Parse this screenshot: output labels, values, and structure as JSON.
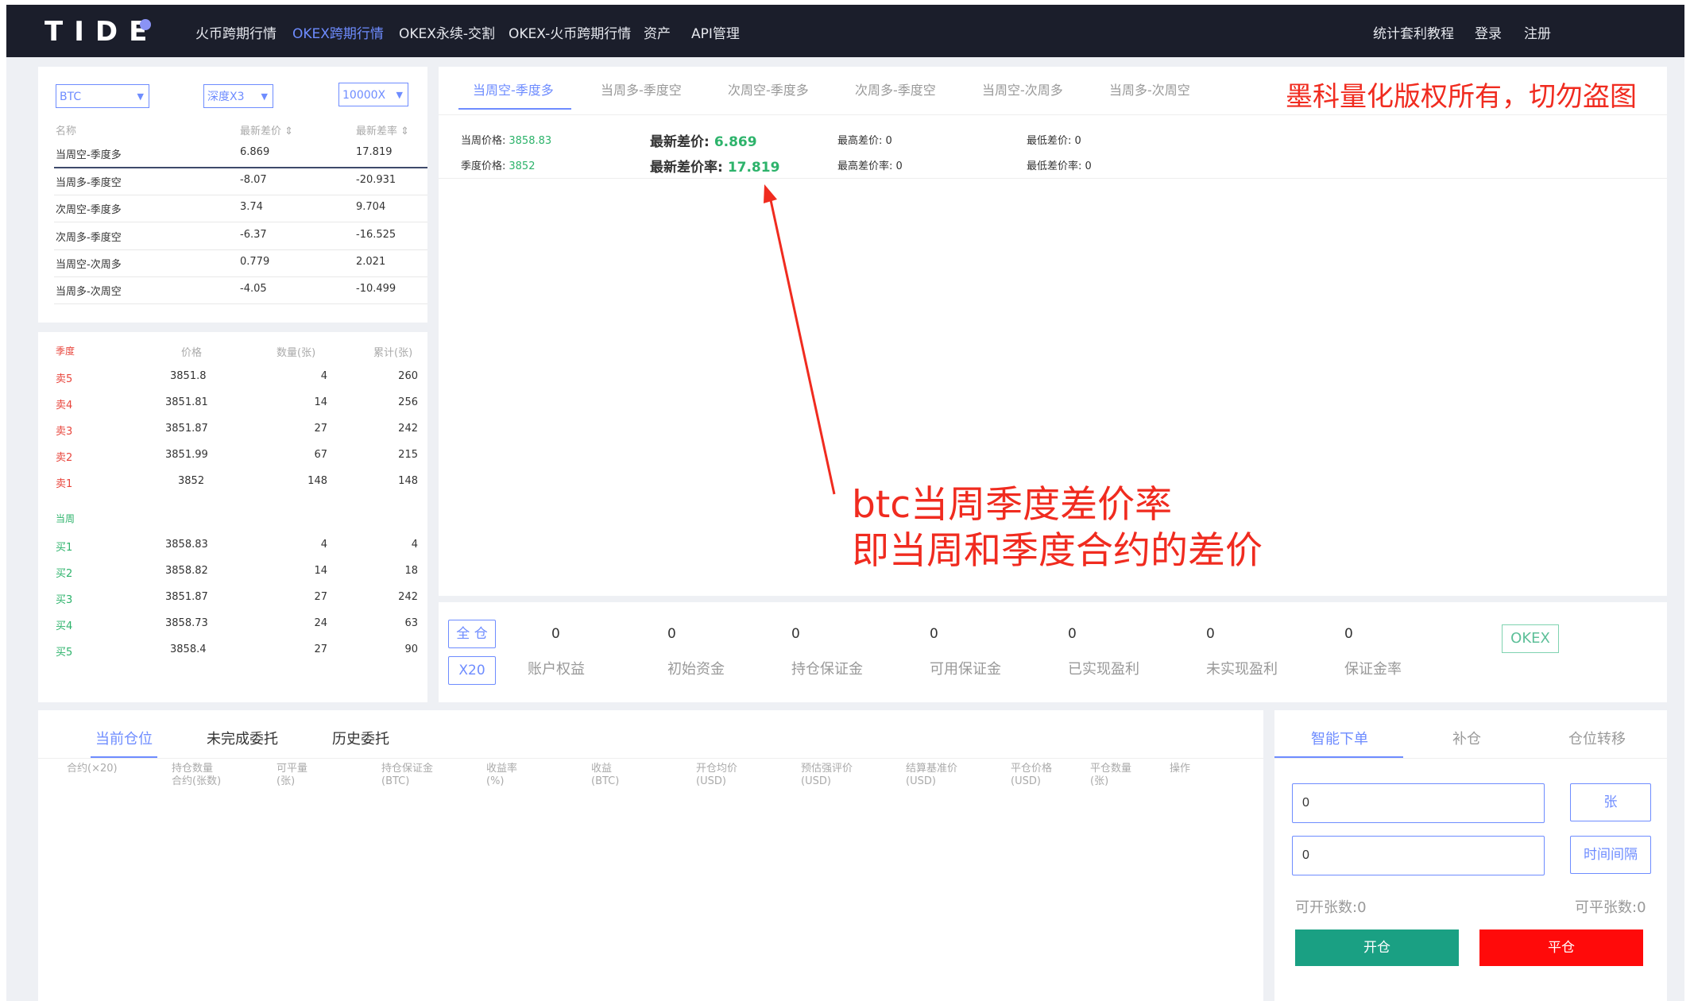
{
  "nav": {
    "logo": "TIDE",
    "items": [
      "火币跨期行情",
      "OKEX跨期行情",
      "OKEX永续-交割",
      "OKEX-火币跨期行情",
      "资产",
      "API管理"
    ],
    "right": [
      "统计套利教程",
      "登录",
      "注册"
    ]
  },
  "filters": {
    "coin": "BTC",
    "depth": "深度X3",
    "amount": "10000X"
  },
  "spread_table": {
    "headers": [
      "名称",
      "最新差价 ⇕",
      "最新差率 ⇕"
    ],
    "rows": [
      [
        "当周空-季度多",
        "6.869",
        "17.819"
      ],
      [
        "当周多-季度空",
        "-8.07",
        "-20.931"
      ],
      [
        "次周空-季度多",
        "3.74",
        "9.704"
      ],
      [
        "次周多-季度空",
        "-6.37",
        "-16.525"
      ],
      [
        "当周空-次周多",
        "0.779",
        "2.021"
      ],
      [
        "当周多-次周空",
        "-4.05",
        "-10.499"
      ]
    ]
  },
  "orderbook": {
    "headers": [
      "季度",
      "价格",
      "数量(张)",
      "累计(张)"
    ],
    "asks": [
      [
        "卖5",
        "3851.8",
        "4",
        "260"
      ],
      [
        "卖4",
        "3851.81",
        "14",
        "256"
      ],
      [
        "卖3",
        "3851.87",
        "27",
        "242"
      ],
      [
        "卖2",
        "3851.99",
        "67",
        "215"
      ],
      [
        "卖1",
        "3852",
        "148",
        "148"
      ]
    ],
    "mid_label": "当周",
    "bids": [
      [
        "买1",
        "3858.83",
        "4",
        "4"
      ],
      [
        "买2",
        "3858.82",
        "14",
        "18"
      ],
      [
        "买3",
        "3851.87",
        "27",
        "242"
      ],
      [
        "买4",
        "3858.73",
        "24",
        "63"
      ],
      [
        "买5",
        "3858.4",
        "27",
        "90"
      ]
    ]
  },
  "chart_tabs": [
    "当周空-季度多",
    "当周多-季度空",
    "次周空-季度多",
    "次周多-季度空",
    "当周空-次周多",
    "当周多-次周空"
  ],
  "watermark": "墨科量化版权所有，切勿盗图",
  "stats": {
    "current_price_label": "当周价格:",
    "current_price": "3858.83",
    "quarter_price_label": "季度价格:",
    "quarter_price": "3852",
    "latest_spread_label": "最新差价:",
    "latest_spread": "6.869",
    "latest_rate_label": "最新差价率:",
    "latest_rate": "17.819",
    "max_spread": "最高差价: 0",
    "max_rate": "最高差价率: 0",
    "min_spread": "最低差价: 0",
    "min_rate": "最低差价率: 0"
  },
  "annotation": {
    "line1": "btc当周季度差价率",
    "line2": "即当周和季度合约的差价"
  },
  "account": {
    "mode": "全 仓",
    "leverage": "X20",
    "exchange": "OKEX",
    "items": [
      {
        "value": "0",
        "label": "账户权益"
      },
      {
        "value": "0",
        "label": "初始资金"
      },
      {
        "value": "0",
        "label": "持仓保证金"
      },
      {
        "value": "0",
        "label": "可用保证金"
      },
      {
        "value": "0",
        "label": "已实现盈利"
      },
      {
        "value": "0",
        "label": "未实现盈利"
      },
      {
        "value": "0",
        "label": "保证金率"
      }
    ]
  },
  "positions": {
    "tabs": [
      "当前仓位",
      "未完成委托",
      "历史委托"
    ],
    "headers": [
      [
        "合约(×20)",
        ""
      ],
      [
        "持仓数量",
        "合约(张数)"
      ],
      [
        "可平量",
        "(张)"
      ],
      [
        "持仓保证金",
        "(BTC)"
      ],
      [
        "收益率",
        "(%)"
      ],
      [
        "收益",
        "(BTC)"
      ],
      [
        "开仓均价",
        "(USD)"
      ],
      [
        "预估强评价",
        "(USD)"
      ],
      [
        "结算基准价",
        "(USD)"
      ],
      [
        "平仓价格",
        "(USD)"
      ],
      [
        "平仓数量",
        "(张)"
      ],
      [
        "操作",
        ""
      ]
    ]
  },
  "order": {
    "tabs": [
      "智能下单",
      "补仓",
      "仓位转移"
    ],
    "qty_value": "0",
    "qty_unit": "张",
    "interval_value": "0",
    "interval_unit": "时间间隔",
    "can_open": "可开张数:0",
    "can_close": "可平张数:0",
    "open_btn": "开仓",
    "close_btn": "平仓"
  },
  "colors": {
    "accent": "#6e8cff",
    "up": "#2db36b",
    "down": "#e8453c",
    "open": "#1aa083",
    "close": "#ff0a0a",
    "annotation": "#f02b1f"
  }
}
